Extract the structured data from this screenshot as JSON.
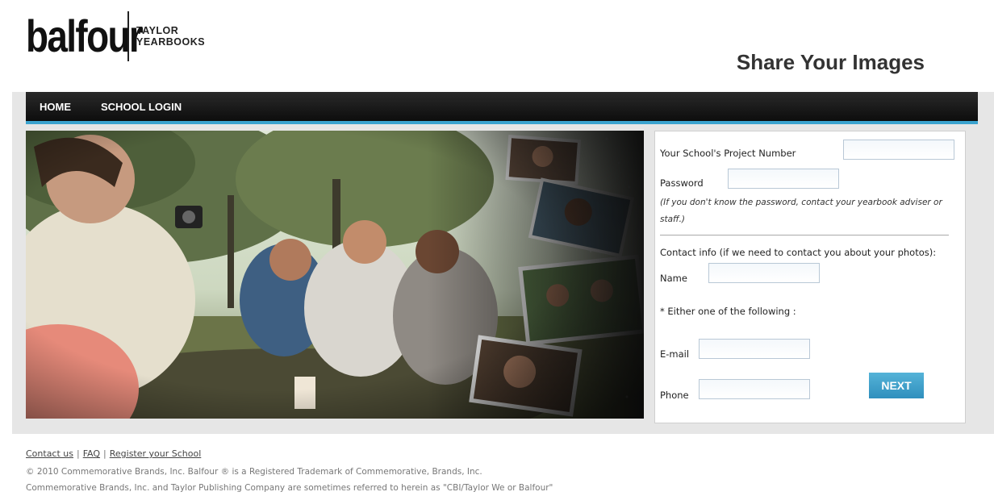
{
  "header": {
    "logo_main": "balfour",
    "logo_sub_line1": "TAYLOR",
    "logo_sub_line2": "YEARBOOKS",
    "title": "Share Your Images"
  },
  "nav": {
    "items": [
      {
        "label": "HOME"
      },
      {
        "label": "SCHOOL LOGIN"
      }
    ]
  },
  "form": {
    "project_number_label": "Your School's Project Number",
    "project_number_value": "",
    "password_label": "Password",
    "password_value": "",
    "password_note": "(If you don't know the password, contact your yearbook adviser or staff.)",
    "contact_heading": "Contact info (if we need to contact you about your photos):",
    "name_label": "Name",
    "name_value": "",
    "either_label": "* Either one of the following :",
    "email_label": "E-mail",
    "email_value": "",
    "phone_label": "Phone",
    "phone_value": "",
    "next_label": "NEXT"
  },
  "footer": {
    "links": [
      {
        "label": "Contact us"
      },
      {
        "label": "FAQ"
      },
      {
        "label": "Register your School"
      }
    ],
    "copyright": "© 2010 Commemorative Brands, Inc. Balfour ® is a Registered Trademark of Commemorative, Brands, Inc.",
    "disclaimer": "Commemorative Brands, Inc. and Taylor Publishing Company are sometimes referred to herein as \"CBI/Taylor We or Balfour\""
  },
  "colors": {
    "accent": "#3ba3cf",
    "nav_bg": "#111111",
    "button": "#3f9fca",
    "panel_bg": "#e6e6e6"
  }
}
